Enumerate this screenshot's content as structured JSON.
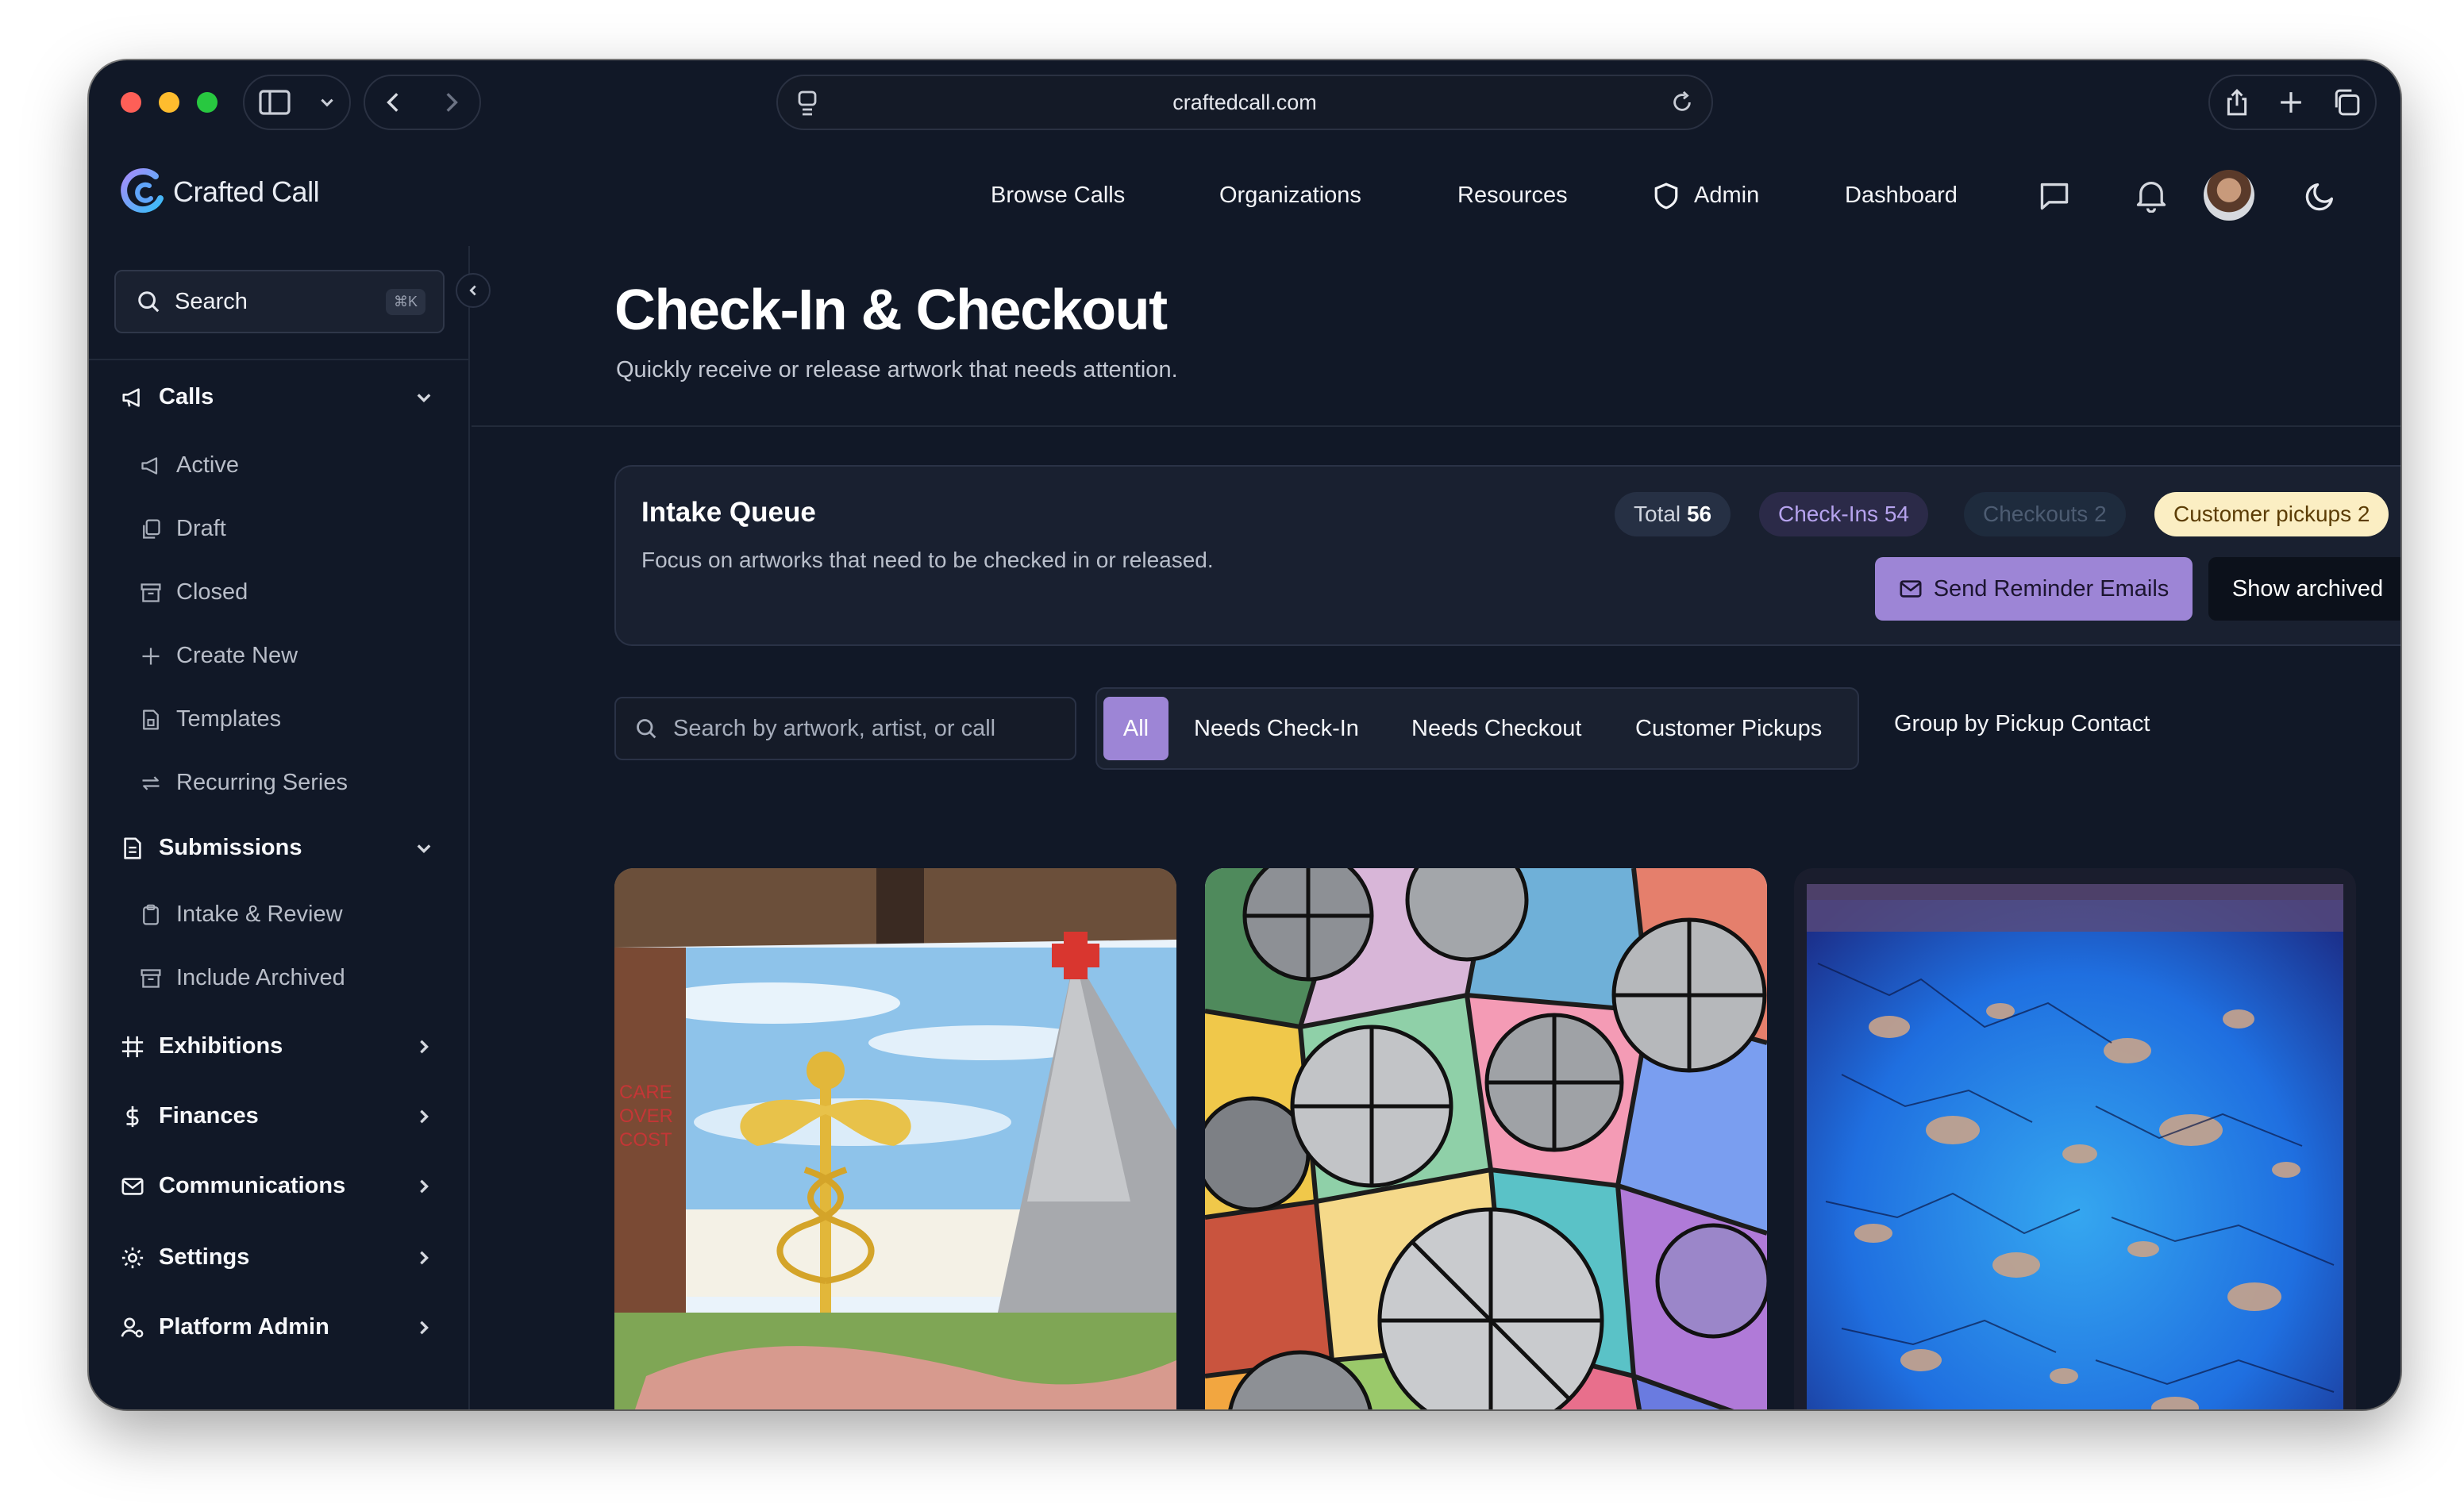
{
  "browser": {
    "url": "craftedcall.com"
  },
  "app": {
    "name": "Crafted Call",
    "nav": [
      "Browse Calls",
      "Organizations",
      "Resources",
      "Admin",
      "Dashboard"
    ]
  },
  "sidebar": {
    "search_label": "Search",
    "search_shortcut": "⌘K",
    "groups": [
      {
        "label": "Calls",
        "icon": "megaphone-icon",
        "expanded": true,
        "items": [
          {
            "label": "Active",
            "icon": "megaphone-icon"
          },
          {
            "label": "Draft",
            "icon": "copy-icon"
          },
          {
            "label": "Closed",
            "icon": "archive-icon"
          },
          {
            "label": "Create New",
            "icon": "plus-icon"
          },
          {
            "label": "Templates",
            "icon": "file-icon"
          },
          {
            "label": "Recurring Series",
            "icon": "repeat-icon"
          }
        ]
      },
      {
        "label": "Submissions",
        "icon": "document-icon",
        "expanded": true,
        "items": [
          {
            "label": "Intake & Review",
            "icon": "clipboard-icon"
          },
          {
            "label": "Include Archived",
            "icon": "archive-icon"
          }
        ]
      },
      {
        "label": "Exhibitions",
        "icon": "hash-icon",
        "expanded": false
      },
      {
        "label": "Finances",
        "icon": "dollar-icon",
        "expanded": false
      },
      {
        "label": "Communications",
        "icon": "mail-icon",
        "expanded": false
      },
      {
        "label": "Settings",
        "icon": "gear-icon",
        "expanded": false
      },
      {
        "label": "Platform Admin",
        "icon": "user-cog-icon",
        "expanded": false
      }
    ]
  },
  "page": {
    "title": "Check-In & Checkout",
    "subtitle": "Quickly receive or release artwork that needs attention."
  },
  "queue": {
    "title": "Intake Queue",
    "subtitle": "Focus on artworks that need to be checked in or released.",
    "badges": {
      "total_label": "Total",
      "total_value": "56",
      "checkins": "Check-Ins 54",
      "checkouts": "Checkouts 2",
      "pickups": "Customer pickups 2"
    },
    "send_reminder": "Send Reminder Emails",
    "show_archived": "Show archived"
  },
  "filters": {
    "search_placeholder": "Search by artwork, artist, or call",
    "tabs": [
      "All",
      "Needs Check-In",
      "Needs Checkout",
      "Customer Pickups"
    ],
    "active_tab": "All",
    "group_by": "Group by Pickup Contact"
  },
  "artworks": [
    {
      "alt": "Painting with caduceus and tower, text CARE OVER COST"
    },
    {
      "alt": "Stained glass style painting with grey spheres"
    },
    {
      "alt": "Blue abstract textured painting"
    }
  ],
  "colors": {
    "background": "#111827",
    "accent": "#9d85d6",
    "panel": "#192030"
  }
}
